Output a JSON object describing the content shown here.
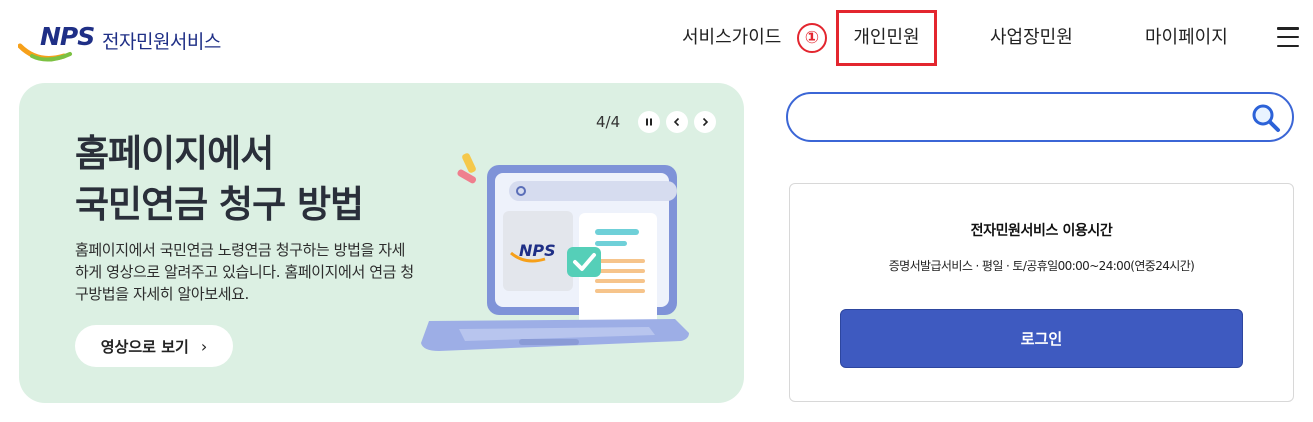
{
  "header": {
    "logo_mark": "NPS",
    "logo_text": "전자민원서비스",
    "nav": {
      "guide": "서비스가이드",
      "marker": "①",
      "personal": "개인민원",
      "business": "사업장민원",
      "mypage": "마이페이지"
    }
  },
  "banner": {
    "title_line1": "홈페이지에서",
    "title_line2": "국민연금 청구 방법",
    "description": "홈페이지에서 국민연금 노령연금 청구하는 방법을 자세하게 영상으로 알려주고 있습니다. 홈페이지에서 연금 청구방법을 자세히 알아보세요.",
    "cta_label": "영상으로 보기",
    "page_indicator": "4/4",
    "illustration_logo": "NPS"
  },
  "search": {
    "placeholder": "",
    "value": ""
  },
  "panel": {
    "title": "전자민원서비스 이용시간",
    "hours": "증명서발급서비스 · 평일 · 토/공휴일00:00~24:00(연중24시간)",
    "login_label": "로그인"
  },
  "colors": {
    "brand_navy": "#1f2f86",
    "highlight_red": "#e3262f",
    "banner_bg": "#dcf0e3",
    "search_border": "#3b66d6",
    "login_bg": "#3e5ac0"
  }
}
